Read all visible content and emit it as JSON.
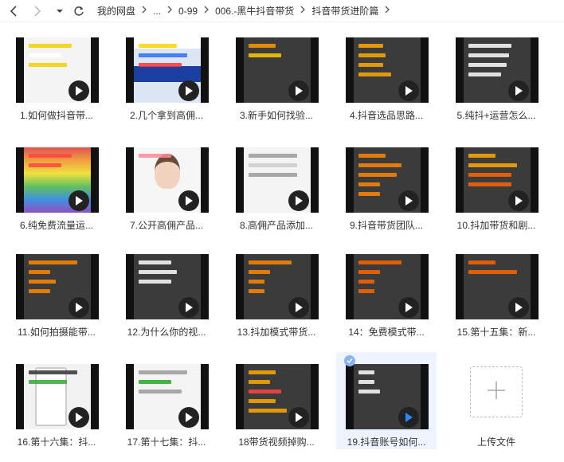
{
  "breadcrumb": [
    "我的网盘",
    "...",
    "0-99",
    "006.-黑牛抖音带货",
    "抖音带货进阶篇"
  ],
  "tiles": [
    {
      "caption": "1.如何做抖音带...",
      "lines": [
        [
          "#f5d000",
          0.8
        ],
        [
          "#ffffff",
          0.6
        ],
        [
          "#f5d000",
          0.7
        ]
      ],
      "style": "web"
    },
    {
      "caption": "2.几个拿到高佣...",
      "lines": [
        [
          "#ffd400",
          0.7
        ],
        [
          "#2a6cff",
          0.9
        ],
        [
          "#ff3333",
          0.8
        ]
      ],
      "style": "web2"
    },
    {
      "caption": "3.新手如何找验...",
      "lines": [
        [
          "#ff9900",
          0.5
        ],
        [
          "#ffcc00",
          0.6
        ]
      ],
      "style": "dark"
    },
    {
      "caption": "4.抖音选品思路...",
      "lines": [
        [
          "#ffaa00",
          0.45
        ],
        [
          "#ffaa00",
          0.5
        ],
        [
          "#ffaa00",
          0.45
        ],
        [
          "#ffaa00",
          0.6
        ]
      ],
      "style": "dark"
    },
    {
      "caption": "5.纯抖+运营怎么...",
      "lines": [
        [
          "#ffffff",
          0.8
        ],
        [
          "#ffffff",
          0.75
        ],
        [
          "#ffffff",
          0.7
        ],
        [
          "#ffffff",
          0.6
        ]
      ],
      "style": "dark"
    },
    {
      "caption": "6.纯免费流量运...",
      "lines": [
        [
          "#ff4444",
          0.8
        ],
        [
          "#ff4444",
          0.6
        ]
      ],
      "style": "rainbow"
    },
    {
      "caption": "7.公开高佣产品...",
      "lines": [
        [
          "#ff8899",
          0.6
        ]
      ],
      "style": "person"
    },
    {
      "caption": "8.高佣产品添加...",
      "lines": [
        [
          "#999999",
          0.9
        ],
        [
          "#cccccc",
          0.9
        ],
        [
          "#999999",
          0.9
        ]
      ],
      "style": "web"
    },
    {
      "caption": "9.抖音带货团队...",
      "lines": [
        [
          "#ff8800",
          0.5
        ],
        [
          "#ff8800",
          0.8
        ],
        [
          "#ff8800",
          0.7
        ],
        [
          "#ff8800",
          0.4
        ],
        [
          "#ff8800",
          0.4
        ]
      ],
      "style": "dark"
    },
    {
      "caption": "10.抖加带货和剧...",
      "lines": [
        [
          "#ffaa00",
          0.5
        ],
        [
          "#ffaa00",
          0.9
        ],
        [
          "#ff6600",
          0.8
        ],
        [
          "#ff6600",
          0.8
        ]
      ],
      "style": "dark"
    },
    {
      "caption": "11.如何拍摄能带...",
      "lines": [
        [
          "#ff8800",
          0.9
        ],
        [
          "#ff8800",
          0.4
        ],
        [
          "#ff8800",
          0.5
        ],
        [
          "#ff8800",
          0.4
        ]
      ],
      "style": "dark"
    },
    {
      "caption": "12.为什么你的视...",
      "lines": [
        [
          "#ffffff",
          0.6
        ],
        [
          "#ffffff",
          0.7
        ],
        [
          "#ffffff",
          0.6
        ]
      ],
      "style": "dark"
    },
    {
      "caption": "13.抖加模式带货...",
      "lines": [
        [
          "#ff8800",
          0.8
        ],
        [
          "#ff8800",
          0.4
        ],
        [
          "#ff8800",
          0.3
        ],
        [
          "#ff8800",
          0.3
        ]
      ],
      "style": "dark"
    },
    {
      "caption": "14：免费模式带...",
      "lines": [
        [
          "#ff6600",
          0.8
        ],
        [
          "#ff6600",
          0.4
        ],
        [
          "#ff6600",
          0.3
        ],
        [
          "#ff6600",
          0.3
        ]
      ],
      "style": "dark"
    },
    {
      "caption": "15.第十五集：新...",
      "lines": [
        [
          "#ff6600",
          0.5
        ],
        [
          "#ff6600",
          0.9
        ]
      ],
      "style": "dark"
    },
    {
      "caption": "16.第十六集：抖...",
      "lines": [
        [
          "#333333",
          0.9
        ],
        [
          "#33aa33",
          0.7
        ]
      ],
      "style": "phone"
    },
    {
      "caption": "17.第十七集：抖...",
      "lines": [
        [
          "#999999",
          0.9
        ],
        [
          "#22aa22",
          0.6
        ],
        [
          "#999999",
          0.8
        ]
      ],
      "style": "web"
    },
    {
      "caption": "18带货视频掉购...",
      "lines": [
        [
          "#ffaa00",
          0.5
        ],
        [
          "#ffaa00",
          0.4
        ],
        [
          "#ff4444",
          0.6
        ],
        [
          "#ffaa00",
          0.5
        ],
        [
          "#ffaa00",
          0.7
        ]
      ],
      "style": "dark"
    },
    {
      "caption": "19.抖音账号如何...",
      "lines": [
        [
          "#ffffff",
          0.3
        ],
        [
          "#ffffff",
          0.3
        ],
        [
          "#ffffff",
          0.4
        ]
      ],
      "style": "dark",
      "selected": true
    }
  ],
  "upload": {
    "label": "上传文件"
  }
}
